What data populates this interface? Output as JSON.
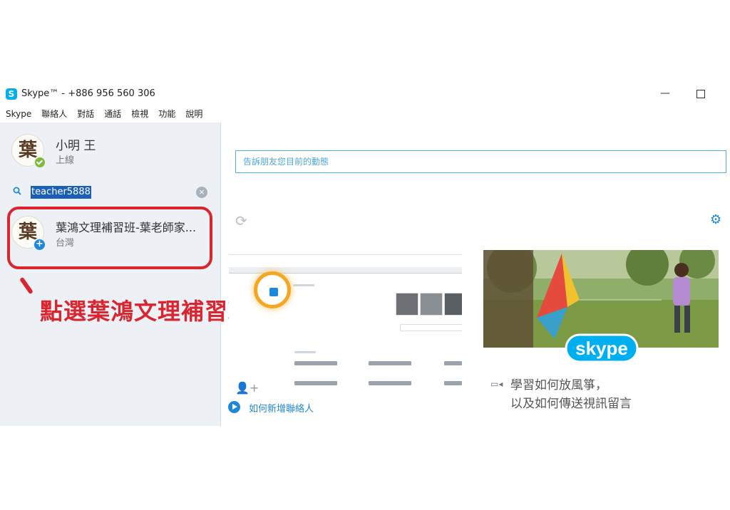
{
  "window": {
    "title": "Skype™ - +886 956 560 306",
    "logo_letter": "S",
    "minimize": "—"
  },
  "menu": [
    "Skype",
    "聯絡人",
    "對話",
    "通話",
    "檢視",
    "功能",
    "說明"
  ],
  "profile": {
    "name": "小明 王",
    "status": "上線",
    "avatar_glyph": "葉"
  },
  "search": {
    "value": "teacher5888",
    "clear": "×"
  },
  "contact": {
    "name": "葉鴻文理補習班-葉老師家...",
    "location": "台灣",
    "avatar_glyph": "葉",
    "add": "+"
  },
  "annotation": "點選葉鴻文理補習班",
  "mood": {
    "placeholder": "告訴朋友您目前的動態"
  },
  "icons": {
    "refresh": "⟳",
    "settings": "⚙",
    "add_contact": "👤+",
    "video": "▭◂"
  },
  "how_to_add": "如何新增聯絡人",
  "promo": {
    "line1": "學習如何放風箏，",
    "line2": "以及如何傳送視訊留言",
    "brand": "skype"
  },
  "colors": {
    "accent": "#1e88d8",
    "annotation": "#d8252f",
    "online": "#7dba3c",
    "skype_blue": "#00aff0"
  }
}
